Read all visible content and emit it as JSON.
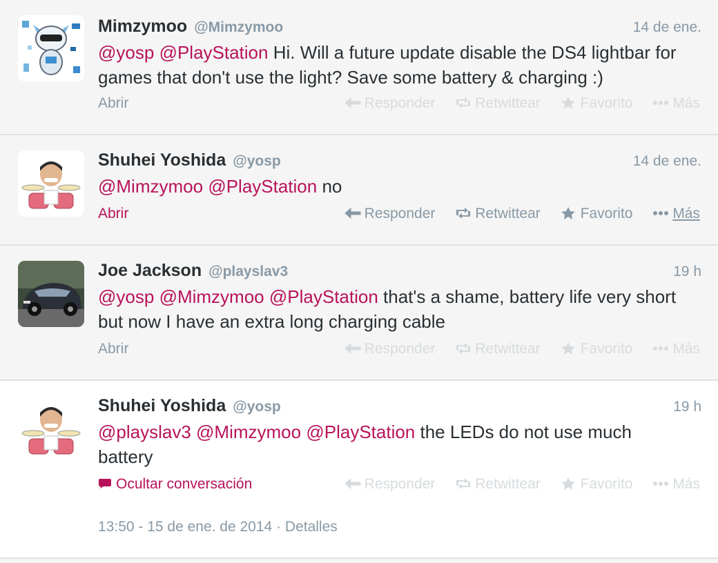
{
  "tweets": [
    {
      "fullname": "Mimzymoo",
      "username": "@Mimzymoo",
      "time": "14 de ene.",
      "mentions": [
        "@yosp",
        "@PlayStation"
      ],
      "text": "Hi. Will a future update disable the DS4 lightbar for games that don't use the light? Save some battery & charging :)",
      "open_label": "Abrir"
    },
    {
      "fullname": "Shuhei Yoshida",
      "username": "@yosp",
      "time": "14 de ene.",
      "mentions": [
        "@Mimzymoo",
        "@PlayStation"
      ],
      "text": "no",
      "open_label": "Abrir"
    },
    {
      "fullname": "Joe Jackson",
      "username": "@playslav3",
      "time": "19 h",
      "mentions": [
        "@yosp",
        "@Mimzymoo",
        "@PlayStation"
      ],
      "text": "that's a shame, battery life very short but now I have an extra long charging cable",
      "open_label": "Abrir"
    },
    {
      "fullname": "Shuhei Yoshida",
      "username": "@yosp",
      "time": "19 h",
      "mentions": [
        "@playslav3",
        "@Mimzymoo",
        "@PlayStation"
      ],
      "text": "the LEDs do not use much battery",
      "hide_label": "Ocultar conversación",
      "timestamp": "13:50 - 15 de ene. de 2014",
      "separator": "·",
      "details_label": "Detalles"
    }
  ],
  "actions": {
    "reply": "Responder",
    "retweet": "Retwittear",
    "favorite": "Favorito",
    "more": "Más"
  },
  "colors": {
    "mention": "#b8125a",
    "muted": "#8899a6",
    "faded": "#d7dbde",
    "text": "#292f33"
  }
}
